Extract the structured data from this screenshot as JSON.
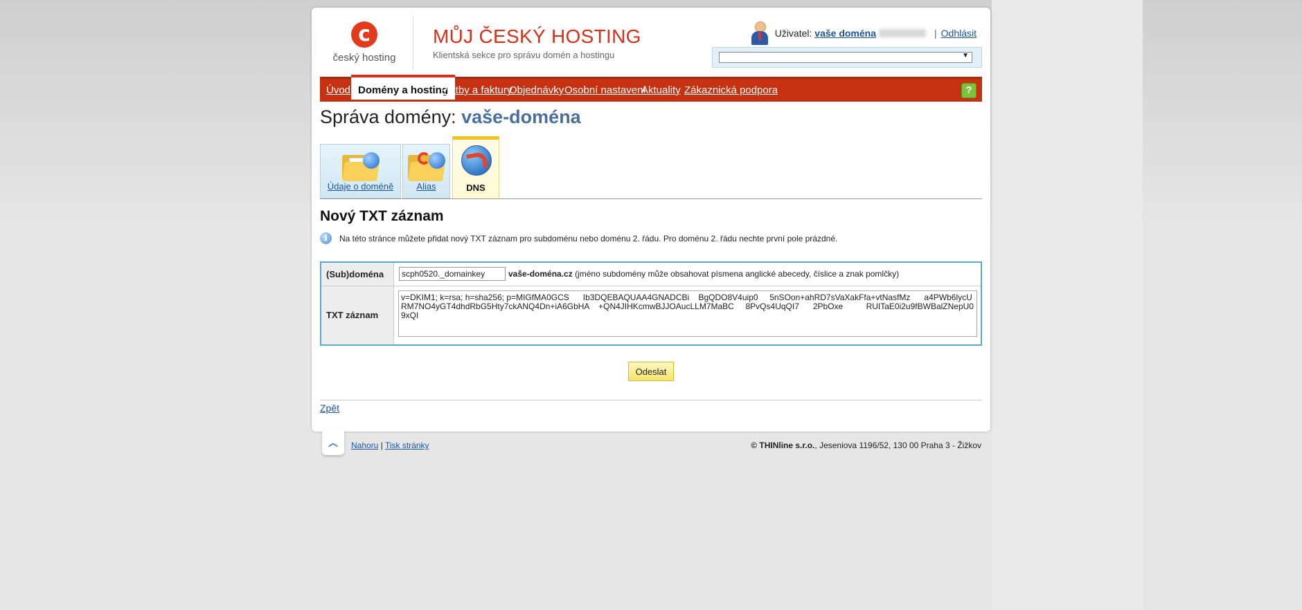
{
  "header": {
    "logo_text": "český hosting",
    "site_title": "MŮJ ČESKÝ HOSTING",
    "site_subtitle": "Klientská sekce pro správu domén a hostingu",
    "user_label": "Uživatel:",
    "user_name": "vaše doména",
    "logout": "Odhlásit",
    "select_value": ""
  },
  "nav": {
    "items": [
      {
        "label": "Úvod"
      },
      {
        "label": "Domény a hosting"
      },
      {
        "label": "Platby a faktury"
      },
      {
        "label": "Objednávky"
      },
      {
        "label": "Osobní nastavení"
      },
      {
        "label": "Aktuality"
      },
      {
        "label": "Zákaznická podpora"
      }
    ],
    "active": "Domény a hosting",
    "help": "?"
  },
  "page": {
    "title_prefix": "Správa domény:",
    "domain": "vaše-doména"
  },
  "tabs": [
    {
      "label": "Údaje o doméně"
    },
    {
      "label": "Alias"
    },
    {
      "label": "DNS"
    }
  ],
  "section": {
    "title": "Nový TXT záznam",
    "info": "Na této stránce můžete přidat nový TXT záznam pro subdoménu nebo doménu 2. řádu. Pro doménu 2. řádu nechte první pole prázdné."
  },
  "form": {
    "subdomain_label": "(Sub)doména",
    "subdomain_value": "scph0520._domainkey",
    "domain_suffix": "vaše-doména.cz",
    "subdomain_hint": "(jméno subdomény může obsahovat písmena anglické abecedy, číslice a znak pomlčky)",
    "txt_label": "TXT záznam",
    "txt_value": "v=DKIM1; k=rsa; h=sha256; p=MIGfMA0GCS      Ib3DQEBAQUAA4GNADCBi    BgQDO8V4uip0     5nSOon+ahRD7sVaXakFfa+vtNasfMz      a4PWb6lycURM7NO4yGT4dhdRbG5Hty7ckANQ4Dn+iA6GbHA    +QN4JIHKcmwBJJOAucLLM7MaBC     8PvQs4UqQI7      2PbOxe          RUITaE0i2u9fBWBalZNepU09xQI",
    "submit": "Odeslat"
  },
  "back": "Zpět",
  "footer": {
    "top": "Nahoru",
    "print": "Tisk stránky",
    "copy_company": "© THINline s.r.o.",
    "copy_address": ", Jeseniova 1196/52, 130 00 Praha 3 - Žižkov"
  }
}
